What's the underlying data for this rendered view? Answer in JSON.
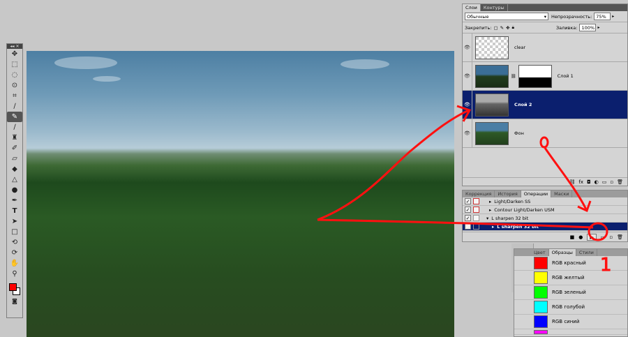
{
  "colors": {
    "annotation": "#ff1010",
    "selected": "#0b1f6e",
    "fg_swatch": "#ff0000",
    "bg_swatch": "#ffffff"
  },
  "toolbox": {
    "header": "◂◂ ✕",
    "tools": [
      "move-tool",
      "marquee-tool",
      "lasso-tool",
      "quick-select-tool",
      "crop-tool",
      "eyedropper-tool",
      "healing-brush-tool",
      "brush-tool",
      "clone-stamp-tool",
      "history-brush-tool",
      "eraser-tool",
      "gradient-tool",
      "blur-tool",
      "dodge-tool",
      "pen-tool",
      "type-tool",
      "path-select-tool",
      "rectangle-tool",
      "3d-rotate-tool",
      "3d-orbit-tool",
      "hand-tool",
      "zoom-tool"
    ]
  },
  "layers_panel": {
    "tabs": [
      "Слои",
      "Контуры"
    ],
    "blend_mode": "Обычные",
    "opacity_label": "Непрозрачность:",
    "opacity_value": "75%",
    "lock_label": "Закрепить:",
    "fill_label": "Заливка:",
    "fill_value": "100%",
    "layers": [
      {
        "name": "clear",
        "selected": false
      },
      {
        "name": "Слой 1",
        "selected": false
      },
      {
        "name": "Слой 2",
        "selected": true
      },
      {
        "name": "Фон",
        "selected": false
      }
    ]
  },
  "actions_panel": {
    "tabs": [
      "Коррекция",
      "История",
      "Операции",
      "Маски"
    ],
    "actions": [
      {
        "name": "Light/Darken SS",
        "selected": false
      },
      {
        "name": "Contour Light/Darken USM",
        "selected": false
      },
      {
        "name": "L sharpen 32 bit",
        "selected": false
      },
      {
        "name": "L sharpen 32 bit",
        "selected": true
      }
    ]
  },
  "swatches_panel": {
    "tabs": [
      "Цвет",
      "Образцы",
      "Стили"
    ],
    "swatches": [
      {
        "name": "RGB красный",
        "color": "#ff0000"
      },
      {
        "name": "RGB желтый",
        "color": "#ffff00"
      },
      {
        "name": "RGB зеленый",
        "color": "#00ff00"
      },
      {
        "name": "RGB голубой",
        "color": "#00ffff"
      },
      {
        "name": "RGB синий",
        "color": "#0000ff"
      },
      {
        "name": "",
        "color": "#ff00ff"
      }
    ]
  },
  "annotation": {
    "number": "1"
  }
}
